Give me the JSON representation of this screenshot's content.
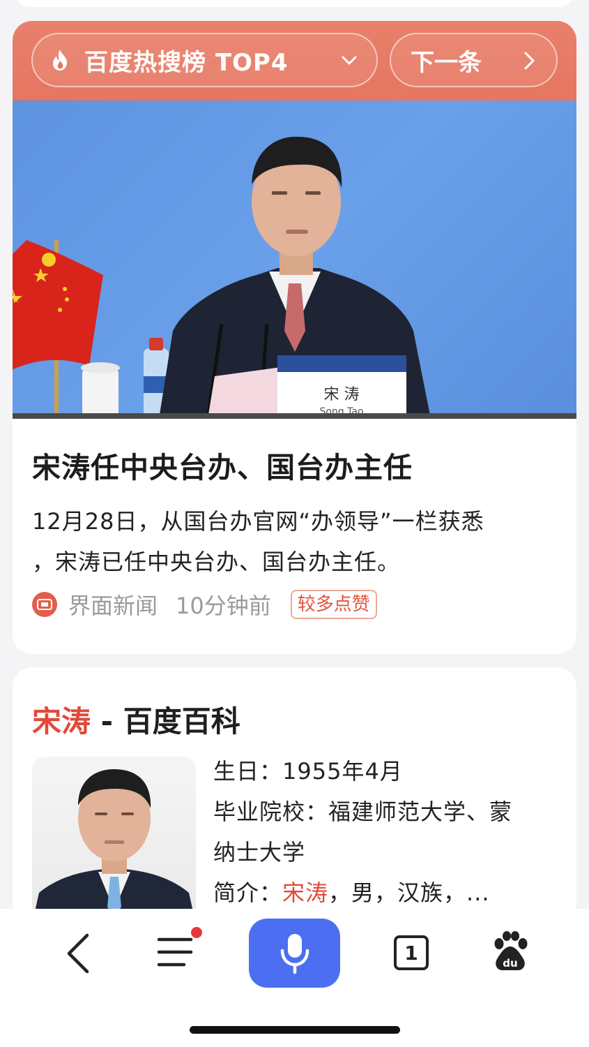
{
  "hot_search": {
    "rank_label": "百度热搜榜 TOP4",
    "next_label": "下一条"
  },
  "news": {
    "photo_nameplate_cn": "宋 涛",
    "photo_nameplate_en": "Song Tao",
    "title": "宋涛任中央台办、国台办主任",
    "desc_line1": "12月28日，从国台办官网“办领导”一栏获悉",
    "desc_line2": "，宋涛已任中央台办、国台办主任。",
    "source": "界面新闻",
    "time": "10分钟前",
    "badge": "较多点赞"
  },
  "baike": {
    "title_name": "宋涛",
    "title_suffix": " - 百度百科",
    "birthday_label": "生日：",
    "birthday_value": "1955年4月",
    "school_label": "毕业院校：",
    "school_value_1": "福建师范大学、蒙",
    "school_value_2": "纳士大学",
    "intro_label": "简介：",
    "intro_name": "宋涛",
    "intro_rest": "，男，汉族，..."
  },
  "bottom_bar": {
    "tab_count": "1"
  },
  "colors": {
    "header": "#e57660",
    "accent_red": "#e04a3a",
    "mic_blue": "#4b6ff0"
  },
  "icons": [
    "flame-icon",
    "chevron-down-icon",
    "chevron-right-icon",
    "source-logo-icon",
    "back-icon",
    "menu-icon",
    "notification-dot",
    "microphone-icon",
    "tabs-icon",
    "baidu-paw-icon"
  ]
}
